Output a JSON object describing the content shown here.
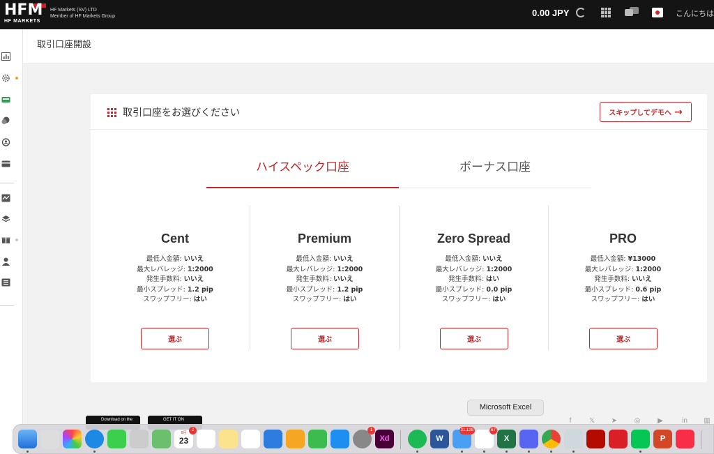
{
  "header": {
    "logo_text": "HFM",
    "logo_sub": "HF MARKETS",
    "company_line1": "HF Markets (SV) LTD",
    "company_line2": "Member of HF Markets Group",
    "balance": "0.00 JPY",
    "greeting": "こんにちは"
  },
  "page": {
    "title": "取引口座開設"
  },
  "card": {
    "title": "取引口座をお選びください",
    "skip_label": "スキップしてデモへ",
    "tabs": [
      {
        "label": "ハイスペック口座",
        "active": true
      },
      {
        "label": "ボーナス口座",
        "active": false
      }
    ],
    "select_label": "選ぶ",
    "plans": [
      {
        "name": "Cent",
        "specs": [
          {
            "k": "最低入金額: ",
            "v": "いいえ"
          },
          {
            "k": "最大レバレッジ: ",
            "v": "1:2000"
          },
          {
            "k": "発生手数料: ",
            "v": "いいえ"
          },
          {
            "k": "最小スプレッド: ",
            "v": "1.2 pip"
          },
          {
            "k": "スワップフリー: ",
            "v": "はい"
          }
        ]
      },
      {
        "name": "Premium",
        "specs": [
          {
            "k": "最低入金額: ",
            "v": "いいえ"
          },
          {
            "k": "最大レバレッジ: ",
            "v": "1:2000"
          },
          {
            "k": "発生手数料: ",
            "v": "いいえ"
          },
          {
            "k": "最小スプレッド: ",
            "v": "1.2 pip"
          },
          {
            "k": "スワップフリー: ",
            "v": "はい"
          }
        ]
      },
      {
        "name": "Zero Spread",
        "specs": [
          {
            "k": "最低入金額: ",
            "v": "いいえ"
          },
          {
            "k": "最大レバレッジ: ",
            "v": "1:2000"
          },
          {
            "k": "発生手数料: ",
            "v": "はい"
          },
          {
            "k": "最小スプレッド: ",
            "v": "0.0 pip"
          },
          {
            "k": "スワップフリー: ",
            "v": "はい"
          }
        ]
      },
      {
        "name": "PRO",
        "specs": [
          {
            "k": "最低入金額: ",
            "v": "¥13000"
          },
          {
            "k": "最大レバレッジ: ",
            "v": "1:2000"
          },
          {
            "k": "発生手数料: ",
            "v": "いいえ"
          },
          {
            "k": "最小スプレッド: ",
            "v": "0.6 pip"
          },
          {
            "k": "スワップフリー: ",
            "v": "はい"
          }
        ]
      }
    ]
  },
  "footer": {
    "app_store": "Download on the",
    "google_play": "GET IT ON"
  },
  "dock": {
    "tooltip": "Microsoft Excel",
    "calendar_day": "23",
    "calendar_month": "8月",
    "calendar_badge": "2",
    "mail_badge": "31,128",
    "slack_badge": "67",
    "settings_badge": "1",
    "xd_label": "Xd",
    "word_label": "W",
    "excel_label": "X",
    "ppt_label": "P"
  }
}
